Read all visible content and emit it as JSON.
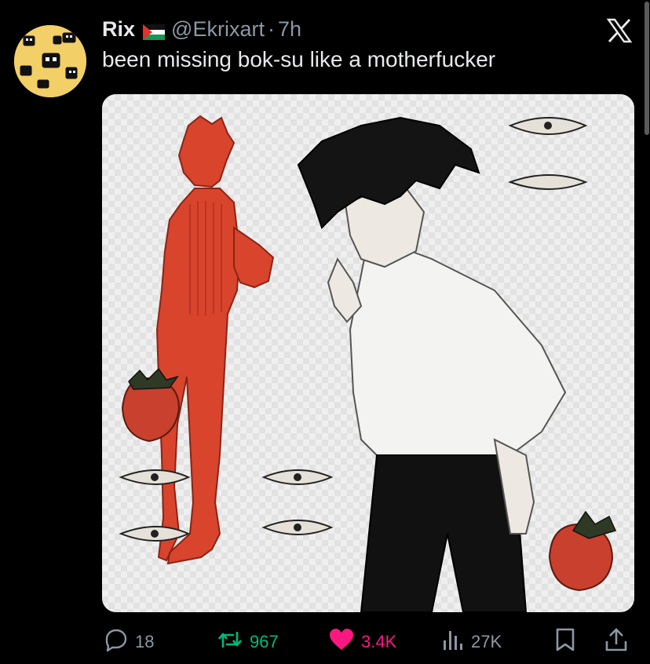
{
  "post": {
    "author_name": "Rix",
    "handle": "@Ekrixart",
    "separator": "·",
    "time": "7h",
    "text": "been missing bok-su like a motherfucker"
  },
  "stats": {
    "replies": "18",
    "reposts": "967",
    "likes": "3.4K",
    "views": "27K"
  },
  "colors": {
    "background": "#000000",
    "text": "#e7e9ea",
    "muted": "#8b98a5",
    "repost": "#00ba7c",
    "like": "#f91880",
    "avatar_bg": "#f2cf67",
    "figure_red": "#d8442c"
  },
  "icons": {
    "flag": "palestine-flag-icon",
    "platform": "x-logo-icon",
    "reply": "reply-icon",
    "repost": "repost-icon",
    "like": "heart-icon",
    "views": "views-icon",
    "bookmark": "bookmark-icon",
    "share": "share-icon"
  }
}
